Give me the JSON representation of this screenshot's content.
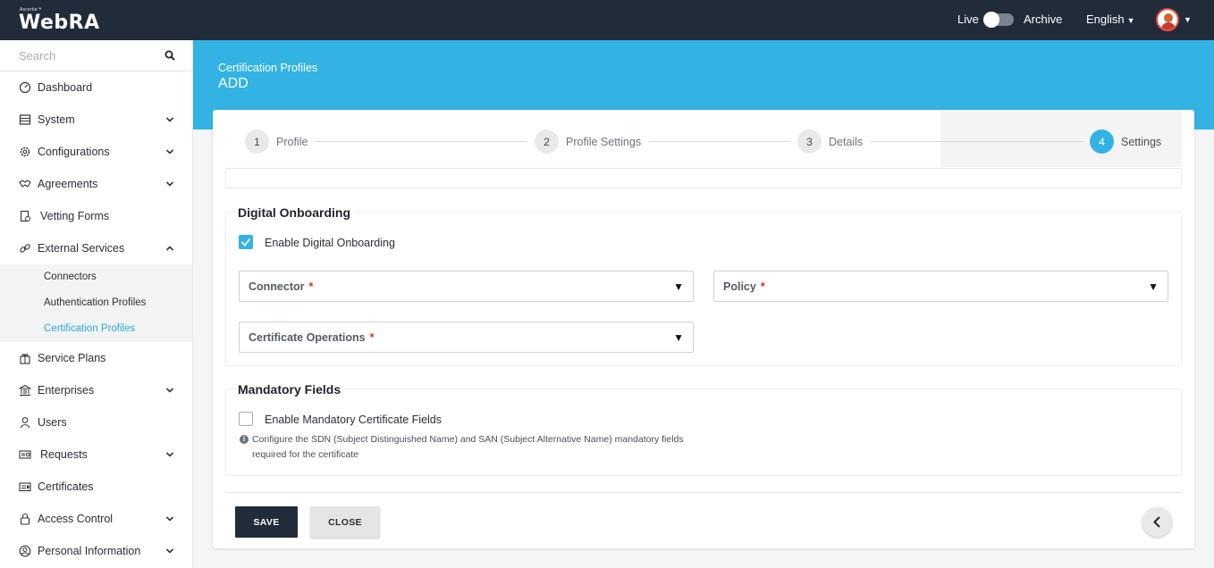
{
  "header": {
    "brand_small": "Ascertia™",
    "brand": "WebRA",
    "live_label": "Live",
    "archive_label": "Archive",
    "language": "English",
    "toggle_on": false
  },
  "sidebar": {
    "search_placeholder": "Search",
    "items": [
      {
        "label": "Dashboard",
        "icon": "dashboard-icon",
        "expandable": false
      },
      {
        "label": "System",
        "icon": "system-icon",
        "expandable": true
      },
      {
        "label": "Configurations",
        "icon": "gear-icon",
        "expandable": true
      },
      {
        "label": "Agreements",
        "icon": "handshake-icon",
        "expandable": true
      },
      {
        "label": "Vetting Forms",
        "icon": "form-icon",
        "expandable": false
      },
      {
        "label": "External Services",
        "icon": "link-icon",
        "expandable": true,
        "expanded": true
      }
    ],
    "sub_items": [
      {
        "label": "Connectors",
        "active": false
      },
      {
        "label": "Authentication Profiles",
        "active": false
      },
      {
        "label": "Certification Profiles",
        "active": true
      }
    ],
    "items_after": [
      {
        "label": "Service Plans",
        "icon": "gift-icon",
        "expandable": false
      },
      {
        "label": "Enterprises",
        "icon": "bank-icon",
        "expandable": true
      },
      {
        "label": "Users",
        "icon": "user-icon",
        "expandable": false
      },
      {
        "label": "Requests",
        "icon": "request-icon",
        "expandable": true
      },
      {
        "label": "Certificates",
        "icon": "certificate-icon",
        "expandable": false
      },
      {
        "label": "Access Control",
        "icon": "lock-icon",
        "expandable": true
      },
      {
        "label": "Personal Information",
        "icon": "user-circle-icon",
        "expandable": true
      }
    ]
  },
  "page": {
    "breadcrumb": "Certification Profiles",
    "title": "ADD",
    "accent": "#33b3e3",
    "navy": "#222b3a"
  },
  "steps": [
    {
      "num": "1",
      "label": "Profile"
    },
    {
      "num": "2",
      "label": "Profile Settings"
    },
    {
      "num": "3",
      "label": "Details"
    },
    {
      "num": "4",
      "label": "Settings",
      "active": true
    }
  ],
  "digital_onboarding": {
    "title": "Digital Onboarding",
    "enable_label": "Enable Digital Onboarding",
    "enabled": true,
    "connector_label": "Connector",
    "policy_label": "Policy",
    "operations_label": "Certificate Operations",
    "required_mark": "*"
  },
  "mandatory_fields": {
    "title": "Mandatory Fields",
    "enable_label": "Enable Mandatory Certificate Fields",
    "enabled": false,
    "info_line1": "Configure the SDN (Subject Distinguished Name) and SAN (Subject Alternative Name) mandatory fields",
    "info_line2": "required for the certificate"
  },
  "actions": {
    "save": "SAVE",
    "close": "CLOSE"
  }
}
